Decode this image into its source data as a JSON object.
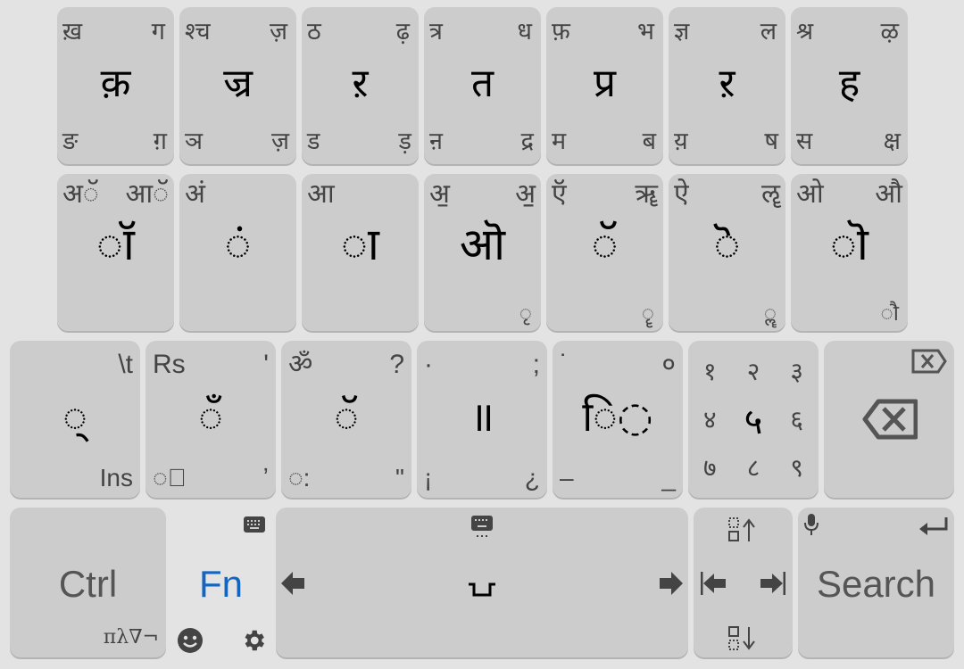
{
  "row1": [
    {
      "tl": "ख़",
      "tr": "ग",
      "c": "क़",
      "bl": "ङ",
      "br": "ग़"
    },
    {
      "tl": "श्च",
      "tr": "ज़",
      "c": "ज्र",
      "bl": "ञ",
      "br": "ज़"
    },
    {
      "tl": "ठ",
      "tr": "ढ़",
      "c": "ऱ",
      "bl": "ड",
      "br": "ड़"
    },
    {
      "tl": "त्र",
      "tr": "ध",
      "c": "त",
      "bl": "ऩ",
      "br": "द्र"
    },
    {
      "tl": "फ़",
      "tr": "भ",
      "c": "प्र",
      "bl": "म",
      "br": "ब"
    },
    {
      "tl": "ज्ञ",
      "tr": "ल",
      "c": "ऱ",
      "bl": "य़",
      "br": "ष"
    },
    {
      "tl": "श्र",
      "tr": "ऴ",
      "c": "ह",
      "bl": "स",
      "br": "क्ष"
    }
  ],
  "row2": [
    {
      "tl": "अॅ",
      "tr": "आॅ",
      "c": "◌ॉ",
      "br": ""
    },
    {
      "tl": "अं",
      "tr": "",
      "c": "◌ं",
      "br": ""
    },
    {
      "tl": "आ",
      "tr": "",
      "c": "◌ा",
      "br": ""
    },
    {
      "tl": "अ॒",
      "tr": "अ॒॒",
      "c": "ऒ",
      "br": "◌ृ"
    },
    {
      "tl": "ऍ",
      "tr": "ॠ",
      "c": "◌ॅ",
      "br": "◌ॄ"
    },
    {
      "tl": "ऐ",
      "tr": "ॡ",
      "c": "◌ॆ",
      "br": "◌ॣ"
    },
    {
      "tl": "ओ",
      "tr": "औ",
      "c": "◌ॊ",
      "br": "◌ौ"
    }
  ],
  "row3": [
    {
      "tl": "",
      "tr": "\\t",
      "c": "◌्",
      "bl": "",
      "br": "Ins"
    },
    {
      "tl": "Rs",
      "tr": "'",
      "c": "◌ँ",
      "bl": "◌॒",
      "br": "ʼ"
    },
    {
      "tl": "ॐ",
      "tr": "?",
      "c": "◌ॅ",
      "bl": "◌:",
      "br": "\""
    },
    {
      "tl": "·",
      "tr": ";",
      "c": "॥",
      "bl": "¡",
      "br": "¿"
    },
    {
      "tl": "˙",
      "tr": "०",
      "c": "ि◌",
      "bl": "–",
      "br": "_"
    }
  ],
  "numpad": [
    "१",
    "२",
    "३",
    "४",
    "५",
    "६",
    "७",
    "८",
    "९"
  ],
  "backspace": {
    "icon": "backspace-icon"
  },
  "bottom": {
    "ctrl_label": "Ctrl",
    "ctrl_sub": "πλ∇¬",
    "fn_label": "Fn",
    "fn_color": "#1565c0",
    "space_symbol": "␣",
    "search_label": "Search"
  }
}
